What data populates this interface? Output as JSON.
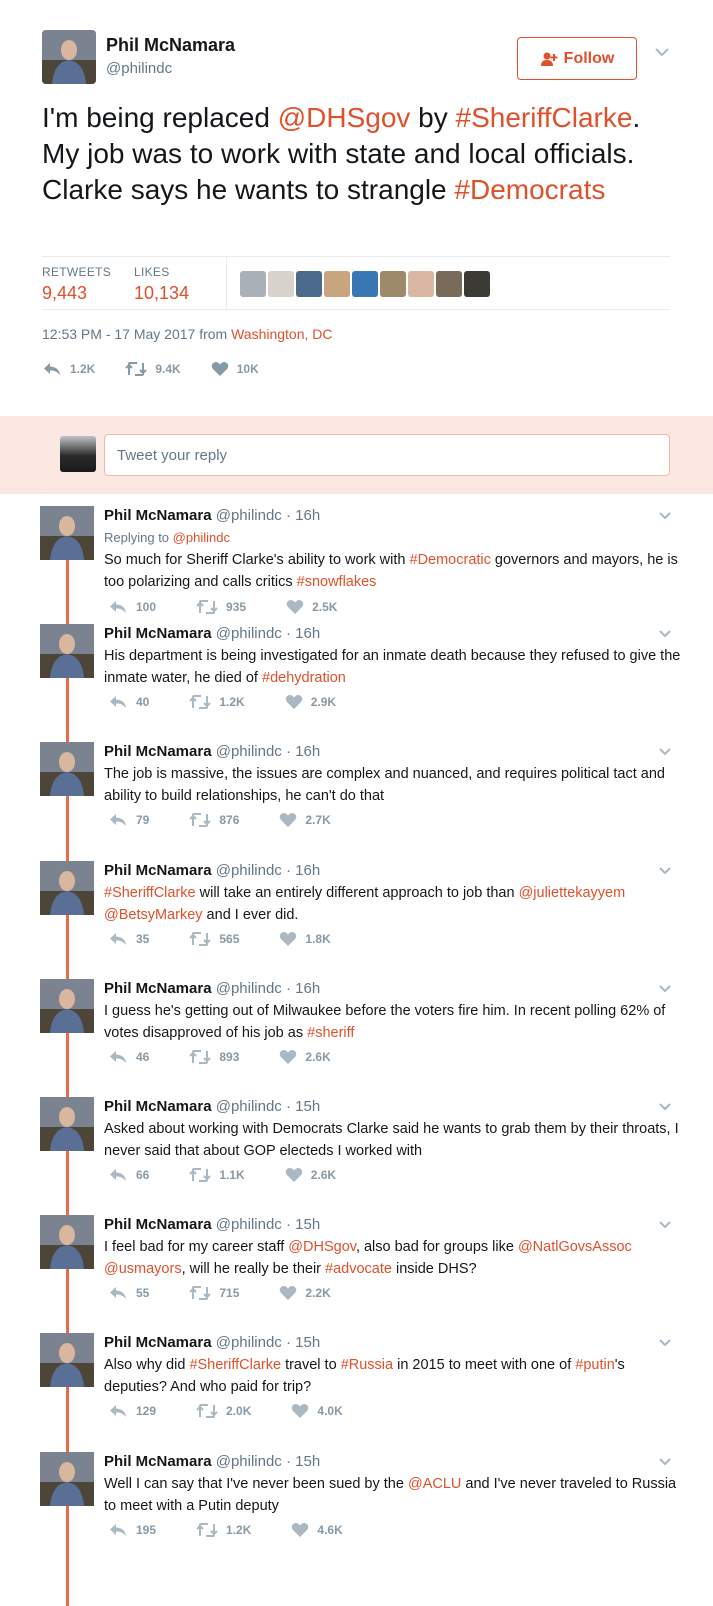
{
  "main": {
    "name": "Phil McNamara",
    "handle": "@philindc",
    "follow_label": "Follow",
    "text_parts": [
      {
        "t": "I'm being replaced ",
        "a": false
      },
      {
        "t": "@DHSgov",
        "a": true
      },
      {
        "t": " by ",
        "a": false
      },
      {
        "t": "#SheriffClarke",
        "a": true
      },
      {
        "t": ". My job was to work with state and local officials. Clarke says he wants to strangle ",
        "a": false
      },
      {
        "t": "#Democrats",
        "a": true
      }
    ],
    "retweets_label": "RETWEETS",
    "retweets": "9,443",
    "likes_label": "LIKES",
    "likes": "10,134",
    "timestamp": "12:53 PM - 17 May 2017 from ",
    "location": "Washington, DC",
    "actions": {
      "reply": "1.2K",
      "retweet": "9.4K",
      "like": "10K"
    }
  },
  "colors": {
    "accent": "#e0502b",
    "reply_bg": "#fbe8e3",
    "thread_line": "#ec6a47",
    "muted": "#657786",
    "likers": [
      "#a9b0b8",
      "#d7d2cc",
      "#4b6a8c",
      "#c9a57e",
      "#3a78b5",
      "#9c8a6a",
      "#d9b7a4",
      "#7a6a5a",
      "#3c3a35"
    ]
  },
  "reply_box": {
    "placeholder": "Tweet your reply"
  },
  "thread": [
    {
      "name": "Phil McNamara",
      "meta": "@philindc · 16h",
      "replying_prefix": "Replying to ",
      "replying_handle": "@philindc",
      "text_parts": [
        {
          "t": "So much for Sheriff Clarke's ability to work with ",
          "a": false
        },
        {
          "t": "#Democratic",
          "a": true
        },
        {
          "t": " governors and mayors, he is too polarizing and calls critics ",
          "a": false
        },
        {
          "t": "#snowflakes",
          "a": true
        }
      ],
      "reply": "100",
      "retweet": "935",
      "like": "2.5K"
    },
    {
      "name": "Phil McNamara",
      "meta": "@philindc · 16h",
      "text_parts": [
        {
          "t": "His department is being investigated for an inmate death because they refused to give the inmate water, he died of ",
          "a": false
        },
        {
          "t": "#dehydration",
          "a": true
        }
      ],
      "reply": "40",
      "retweet": "1.2K",
      "like": "2.9K"
    },
    {
      "name": "Phil McNamara",
      "meta": "@philindc · 16h",
      "text_parts": [
        {
          "t": "The job is massive, the issues are complex and nuanced, and requires political tact and ability to build relationships, he can't do that",
          "a": false
        }
      ],
      "reply": "79",
      "retweet": "876",
      "like": "2.7K"
    },
    {
      "name": "Phil McNamara",
      "meta": "@philindc · 16h",
      "text_parts": [
        {
          "t": "#SheriffClarke",
          "a": true
        },
        {
          "t": " will take an entirely different approach to job than ",
          "a": false
        },
        {
          "t": "@juliettekayyem",
          "a": true
        },
        {
          "t": " ",
          "a": false
        },
        {
          "t": "@BetsyMarkey",
          "a": true
        },
        {
          "t": " and I ever did.",
          "a": false
        }
      ],
      "reply": "35",
      "retweet": "565",
      "like": "1.8K"
    },
    {
      "name": "Phil McNamara",
      "meta": "@philindc · 16h",
      "text_parts": [
        {
          "t": "I guess he's getting out of Milwaukee before the voters fire him. In recent polling 62% of votes disapproved of his job as ",
          "a": false
        },
        {
          "t": "#sheriff",
          "a": true
        }
      ],
      "reply": "46",
      "retweet": "893",
      "like": "2.6K"
    },
    {
      "name": "Phil McNamara",
      "meta": "@philindc · 15h",
      "text_parts": [
        {
          "t": "Asked about working with Democrats Clarke said he wants to grab them by their throats, I never said that about GOP electeds I worked with",
          "a": false
        }
      ],
      "reply": "66",
      "retweet": "1.1K",
      "like": "2.6K"
    },
    {
      "name": "Phil McNamara",
      "meta": "@philindc · 15h",
      "text_parts": [
        {
          "t": "I feel bad for my career staff ",
          "a": false
        },
        {
          "t": "@DHSgov",
          "a": true
        },
        {
          "t": ", also  bad for groups like ",
          "a": false
        },
        {
          "t": "@NatlGovsAssoc",
          "a": true
        },
        {
          "t": " ",
          "a": false
        },
        {
          "t": "@usmayors",
          "a": true
        },
        {
          "t": ", will he really be their ",
          "a": false
        },
        {
          "t": "#advocate",
          "a": true
        },
        {
          "t": " inside DHS?",
          "a": false
        }
      ],
      "reply": "55",
      "retweet": "715",
      "like": "2.2K"
    },
    {
      "name": "Phil McNamara",
      "meta": "@philindc · 15h",
      "text_parts": [
        {
          "t": "Also why did ",
          "a": false
        },
        {
          "t": "#SheriffClarke",
          "a": true
        },
        {
          "t": " travel to ",
          "a": false
        },
        {
          "t": "#Russia",
          "a": true
        },
        {
          "t": " in 2015 to meet with one of ",
          "a": false
        },
        {
          "t": "#putin",
          "a": true
        },
        {
          "t": "'s deputies? And who paid for trip?",
          "a": false
        }
      ],
      "reply": "129",
      "retweet": "2.0K",
      "like": "4.0K"
    },
    {
      "name": "Phil McNamara",
      "meta": "@philindc · 15h",
      "text_parts": [
        {
          "t": "Well I can say that I've never been sued by the ",
          "a": false
        },
        {
          "t": "@ACLU",
          "a": true
        },
        {
          "t": " and I've never traveled to Russia to meet with a Putin deputy",
          "a": false
        }
      ],
      "reply": "195",
      "retweet": "1.2K",
      "like": "4.6K"
    }
  ]
}
